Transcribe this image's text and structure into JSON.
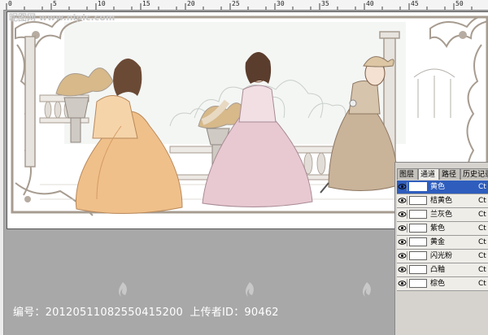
{
  "ruler": {
    "ticks": [
      "0",
      "5",
      "10",
      "15",
      "20",
      "25",
      "30",
      "35",
      "40",
      "45",
      "50"
    ]
  },
  "watermark": {
    "top_left": "昵图网 www.nipic.com"
  },
  "footer": {
    "id_label": "编号：",
    "id_value": "20120511082550415200",
    "uploader_label": "上传者ID：",
    "uploader_value": "90462"
  },
  "channels_panel": {
    "tabs": [
      "图层",
      "通道",
      "路径",
      "历史记录"
    ],
    "active_tab": "通道",
    "channels": [
      {
        "name": "黄色",
        "shortcut": "Ct",
        "selected": true
      },
      {
        "name": "桔黄色",
        "shortcut": "Ct",
        "selected": false
      },
      {
        "name": "兰灰色",
        "shortcut": "Ct",
        "selected": false
      },
      {
        "name": "紫色",
        "shortcut": "Ct",
        "selected": false
      },
      {
        "name": "黄金",
        "shortcut": "Ct",
        "selected": false
      },
      {
        "name": "闪光粉",
        "shortcut": "Ct",
        "selected": false
      },
      {
        "name": "凸釉",
        "shortcut": "Ct",
        "selected": false
      },
      {
        "name": "棕色",
        "shortcut": "Ct",
        "selected": false
      }
    ]
  },
  "colors": {
    "workspace": "#a8a8a8",
    "panel_bg": "#d6d3ce",
    "selection": "#2e5dbd",
    "frame_ornament": "#a79c90",
    "dress_orange": "#f0c08a",
    "dress_pink": "#e8c9d2",
    "dress_brown": "#c9b399"
  }
}
